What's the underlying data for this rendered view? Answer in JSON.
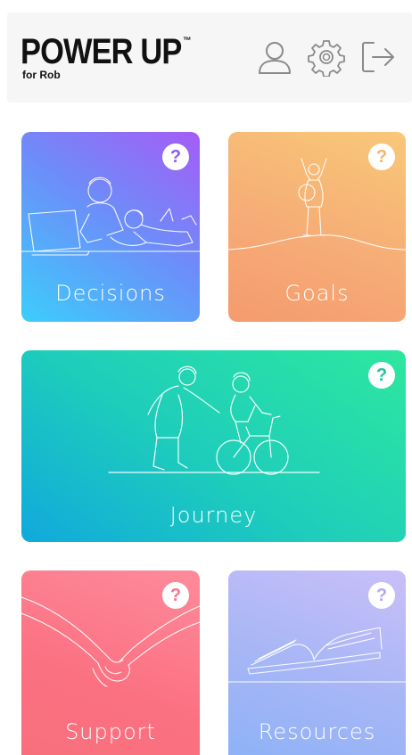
{
  "header": {
    "logo_title": "POWER UP",
    "logo_tm": "™",
    "logo_subtitle": "for Rob",
    "icons": [
      "user-icon",
      "gear-icon",
      "logout-icon"
    ]
  },
  "cards": {
    "decisions": {
      "label": "Decisions",
      "help": "?",
      "help_color": "#8b5cf6"
    },
    "goals": {
      "label": "Goals",
      "help": "?",
      "help_color": "#f6b46b"
    },
    "journey": {
      "label": "Journey",
      "help": "?",
      "help_color": "#20c59a"
    },
    "support": {
      "label": "Support",
      "help": "?",
      "help_color": "#f9738a"
    },
    "resources": {
      "label": "Resources",
      "help": "?",
      "help_color": "#b5a8f3"
    }
  }
}
